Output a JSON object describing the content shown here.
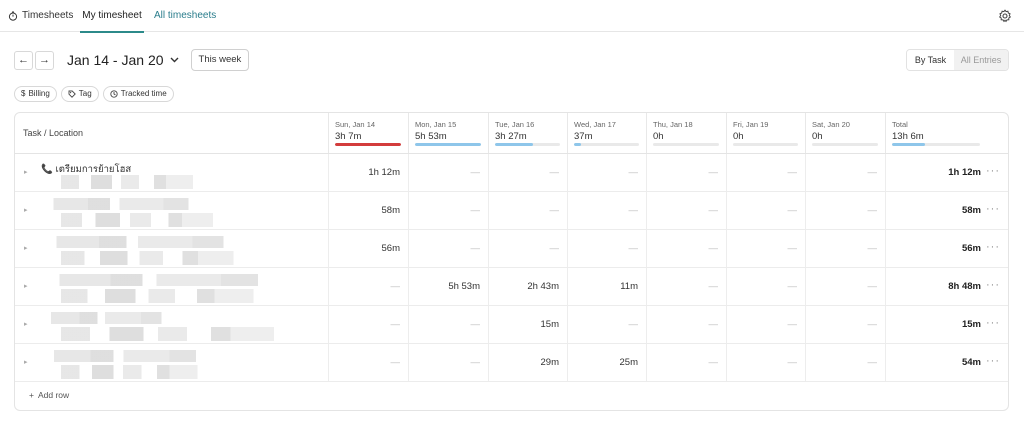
{
  "topbar": {
    "logo_label": "Timesheets",
    "tabs": [
      {
        "label": "My timesheet",
        "active": true
      },
      {
        "label": "All timesheets",
        "active": false
      }
    ],
    "settings_icon": "gear-icon"
  },
  "week": {
    "range": "Jan 14 - Jan 20",
    "this_week_label": "This week",
    "prev_icon": "←",
    "next_icon": "→"
  },
  "view_toggle": {
    "by_task": "By Task",
    "all_entries": "All Entries",
    "selected": "By Task"
  },
  "filters": [
    {
      "icon": "$",
      "label": "Billing"
    },
    {
      "icon": "tag-icon",
      "label": "Tag"
    },
    {
      "icon": "clock-icon",
      "label": "Tracked time"
    }
  ],
  "colors": {
    "accent": "#2c8a8a",
    "over": "#d33c3c",
    "progress": "#8ec6ea"
  },
  "grid": {
    "task_header": "Task / Location",
    "days": [
      {
        "date": "Sun, Jan 14",
        "total": "3h 7m",
        "progress": 1.0,
        "color": "#d33c3c"
      },
      {
        "date": "Mon, Jan 15",
        "total": "5h 53m",
        "progress": 1.0,
        "color": "#8ec6ea"
      },
      {
        "date": "Tue, Jan 16",
        "total": "3h 27m",
        "progress": 0.58,
        "color": "#8ec6ea"
      },
      {
        "date": "Wed, Jan 17",
        "total": "37m",
        "progress": 0.1,
        "color": "#8ec6ea"
      },
      {
        "date": "Thu, Jan 18",
        "total": "0h",
        "progress": 0,
        "color": "#8ec6ea"
      },
      {
        "date": "Fri, Jan 19",
        "total": "0h",
        "progress": 0,
        "color": "#8ec6ea"
      },
      {
        "date": "Sat, Jan 20",
        "total": "0h",
        "progress": 0,
        "color": "#8ec6ea"
      }
    ],
    "total_header": {
      "label": "Total",
      "total": "13h 6m",
      "progress": 0.37
    },
    "rows": [
      {
        "name": "📞 เตรียมการย้ายโฮส",
        "cells": [
          "1h 12m",
          "—",
          "—",
          "—",
          "—",
          "—",
          "—"
        ],
        "total": "1h 12m"
      },
      {
        "name": "",
        "cells": [
          "58m",
          "—",
          "—",
          "—",
          "—",
          "—",
          "—"
        ],
        "total": "58m"
      },
      {
        "name": "",
        "cells": [
          "56m",
          "—",
          "—",
          "—",
          "—",
          "—",
          "—"
        ],
        "total": "56m"
      },
      {
        "name": "",
        "cells": [
          "—",
          "5h 53m",
          "2h 43m",
          "11m",
          "—",
          "—",
          "—"
        ],
        "total": "8h 48m"
      },
      {
        "name": "",
        "cells": [
          "—",
          "—",
          "15m",
          "—",
          "—",
          "—",
          "—"
        ],
        "total": "15m"
      },
      {
        "name": "",
        "cells": [
          "—",
          "—",
          "29m",
          "25m",
          "—",
          "—",
          "—"
        ],
        "total": "54m"
      }
    ],
    "add_row_label": "Add row",
    "more_icon": "···"
  }
}
